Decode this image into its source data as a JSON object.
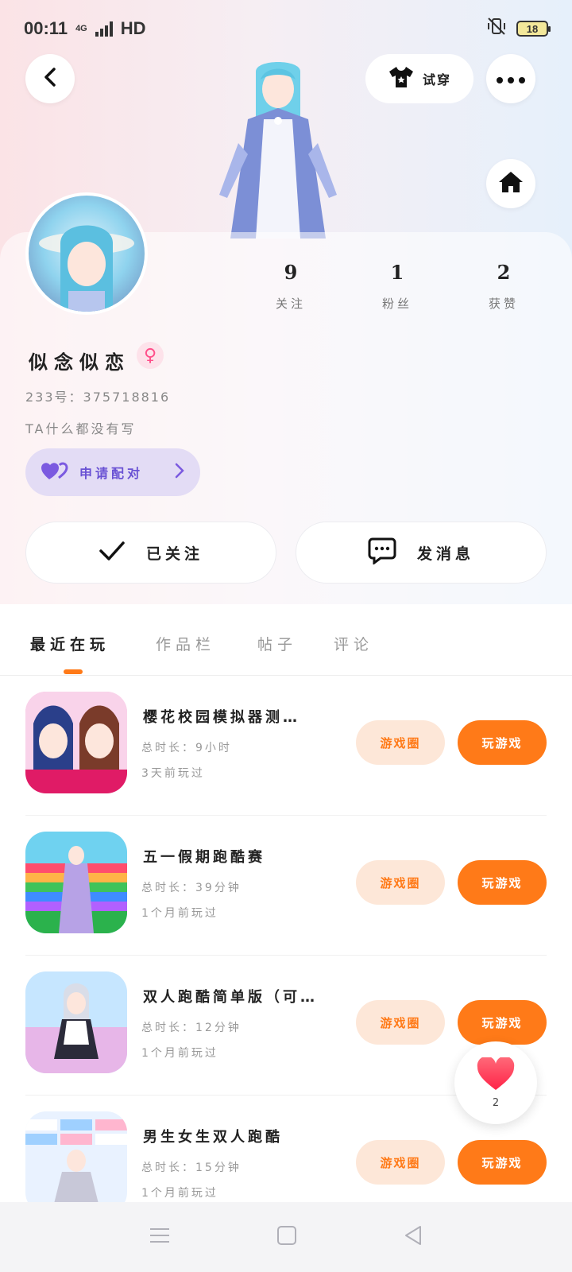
{
  "status_bar": {
    "time": "00:11",
    "network": "4G",
    "hd": "HD",
    "battery": "18"
  },
  "header": {
    "try_on_label": "试穿",
    "icons": {
      "back": "back-arrow-icon",
      "shirt": "shirt-icon",
      "more": "more-dots-icon",
      "home": "home-icon"
    }
  },
  "profile": {
    "nickname": "似念似恋",
    "gender": "female",
    "uid": "233号：375718816",
    "bio": "TA什么都没有写",
    "match_label": "申请配对",
    "stats": [
      {
        "value": "9",
        "label": "关注"
      },
      {
        "value": "1",
        "label": "粉丝"
      },
      {
        "value": "2",
        "label": "获赞"
      }
    ],
    "follow_label": "已关注",
    "message_label": "发消息"
  },
  "tabs": [
    {
      "label": "最近在玩",
      "active": true
    },
    {
      "label": "作品栏",
      "active": false
    },
    {
      "label": "帖子",
      "active": false
    },
    {
      "label": "评论",
      "active": false
    }
  ],
  "games": [
    {
      "title": "樱花校园模拟器测…",
      "playtime": "总时长：9小时",
      "last_played": "3天前玩过",
      "circle_label": "游戏圈",
      "play_label": "玩游戏"
    },
    {
      "title": "五一假期跑酷赛",
      "playtime": "总时长：39分钟",
      "last_played": "1个月前玩过",
      "circle_label": "游戏圈",
      "play_label": "玩游戏"
    },
    {
      "title": "双人跑酷简单版（可…",
      "playtime": "总时长：12分钟",
      "last_played": "1个月前玩过",
      "circle_label": "游戏圈",
      "play_label": "玩游戏"
    },
    {
      "title": "男生女生双人跑酷",
      "playtime": "总时长：15分钟",
      "last_played": "1个月前玩过",
      "circle_label": "游戏圈",
      "play_label": "玩游戏"
    }
  ],
  "like_float": {
    "count": "2"
  },
  "colors": {
    "accent": "#ff7a18",
    "accent_light": "#fde7d8",
    "match_bg": "#e3dcf5",
    "match_text": "#6a52d4",
    "gender": "#ff4f8a"
  }
}
